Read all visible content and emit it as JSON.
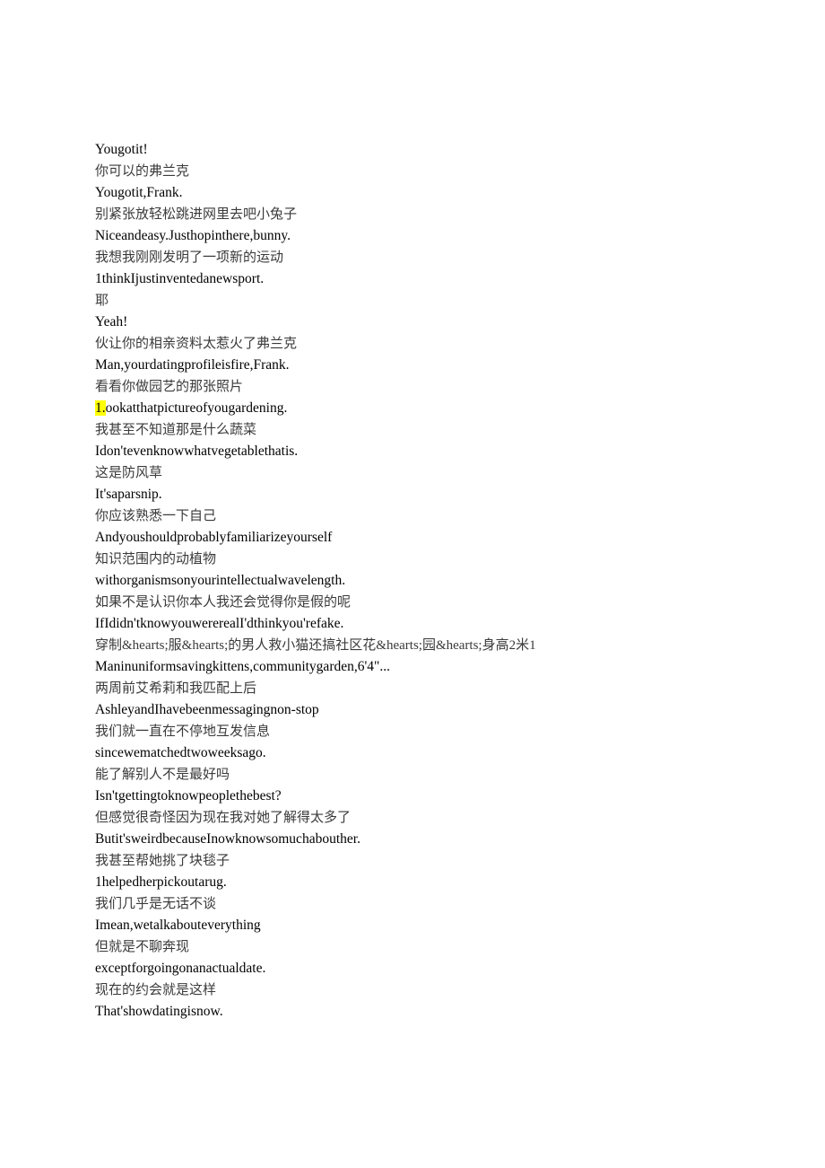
{
  "document": {
    "type": "bilingual-subtitle-transcript",
    "background_color": "#ffffff",
    "text_color_english": "#000000",
    "text_color_chinese": "#3a3a3a",
    "highlight_color": "#ffff00",
    "lines": [
      {
        "lang": "en",
        "text": "Yougotit!"
      },
      {
        "lang": "zh",
        "text": "你可以的弗兰克"
      },
      {
        "lang": "en",
        "text": "Yougotit,Frank."
      },
      {
        "lang": "zh",
        "text": "别紧张放轻松跳进网里去吧小兔子"
      },
      {
        "lang": "en",
        "text": "Niceandeasy.Justhopinthere,bunny."
      },
      {
        "lang": "zh",
        "text": "我想我刚刚发明了一项新的运动"
      },
      {
        "lang": "en",
        "text": "1thinkIjustinventedanewsport."
      },
      {
        "lang": "zh",
        "text": "耶"
      },
      {
        "lang": "en",
        "text": "Yeah!"
      },
      {
        "lang": "zh",
        "text": "伙让你的相亲资料太惹火了弗兰克"
      },
      {
        "lang": "en",
        "text": "Man,yourdatingprofileisfire,Frank."
      },
      {
        "lang": "zh",
        "text": "看看你做园艺的那张照片"
      },
      {
        "lang": "en",
        "highlight_prefix": "1.",
        "text": "ookatthatpictureofyougardening."
      },
      {
        "lang": "zh",
        "text": "我甚至不知道那是什么蔬菜"
      },
      {
        "lang": "en",
        "text": "Idon'tevenknowwhatvegetablethatis."
      },
      {
        "lang": "zh",
        "text": "这是防风草"
      },
      {
        "lang": "en",
        "text": "It'saparsnip."
      },
      {
        "lang": "zh",
        "text": "你应该熟悉一下自己"
      },
      {
        "lang": "en",
        "text": "Andyoushouldprobablyfamiliarizeyourself"
      },
      {
        "lang": "zh",
        "text": "知识范围内的动植物"
      },
      {
        "lang": "en",
        "text": "withorganismsonyourintellectualwavelength."
      },
      {
        "lang": "zh",
        "text": "如果不是认识你本人我还会觉得你是假的呢"
      },
      {
        "lang": "en",
        "text": "IfIdidn'tknowyouwererealI'dthinkyou'refake."
      },
      {
        "lang": "zh",
        "text": "穿制&hearts;服&hearts;的男人救小猫还搞社区花&hearts;园&hearts;身高2米1"
      },
      {
        "lang": "en",
        "text": "Maninuniformsavingkittens,communitygarden,6'4\"..."
      },
      {
        "lang": "zh",
        "text": "两周前艾希莉和我匹配上后"
      },
      {
        "lang": "en",
        "text": "AshleyandIhavebeenmessagingnon-stop"
      },
      {
        "lang": "zh",
        "text": "我们就一直在不停地互发信息"
      },
      {
        "lang": "en",
        "text": "sincewematchedtwoweeksago."
      },
      {
        "lang": "zh",
        "text": "能了解别人不是最好吗"
      },
      {
        "lang": "en",
        "text": "Isn'tgettingtoknowpeoplethebest?"
      },
      {
        "lang": "zh",
        "text": "但感觉很奇怪因为现在我对她了解得太多了"
      },
      {
        "lang": "en",
        "text": "Butit'sweirdbecauseInowknowsomuchabouther."
      },
      {
        "lang": "zh",
        "text": "我甚至帮她挑了块毯子"
      },
      {
        "lang": "en",
        "text": "1helpedherpickoutarug."
      },
      {
        "lang": "zh",
        "text": "我们几乎是无话不谈"
      },
      {
        "lang": "en",
        "text": "Imean,wetalkabouteverything"
      },
      {
        "lang": "zh",
        "text": "但就是不聊奔现"
      },
      {
        "lang": "en",
        "text": "exceptforgoingonanactualdate."
      },
      {
        "lang": "zh",
        "text": "现在的约会就是这样"
      },
      {
        "lang": "en",
        "text": "That'showdatingisnow."
      }
    ]
  }
}
